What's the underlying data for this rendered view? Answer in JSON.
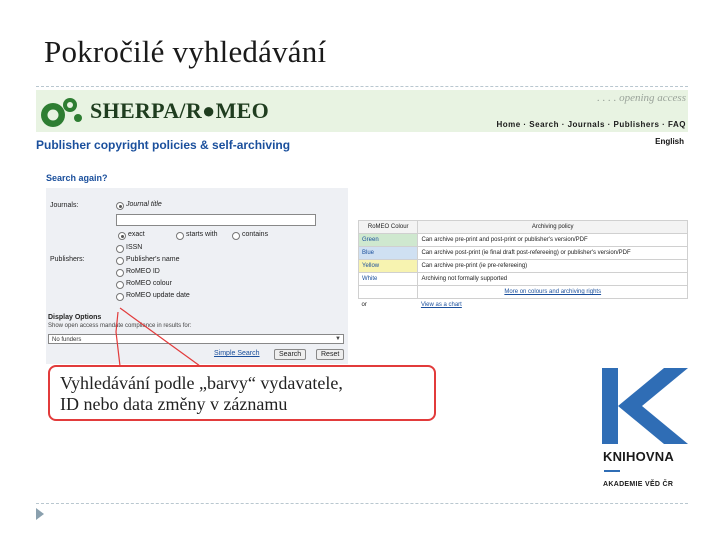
{
  "slide": {
    "title": "Pokročilé vyhledávání"
  },
  "romeo": {
    "brand": "SHERPA/R●MEO",
    "tagline": ". . . . opening access",
    "nav": [
      "Home",
      "Search",
      "Journals",
      "Publishers",
      "FAQ"
    ],
    "subtitle": "Publisher copyright policies & self-archiving",
    "language": "English",
    "search_again": "Search again?",
    "form": {
      "journals_label": "Journals:",
      "journal_title_option": "Journal title",
      "journal_title_value": "",
      "match_options": [
        "exact",
        "starts with",
        "contains"
      ],
      "issn_option": "ISSN",
      "publishers_label": "Publishers:",
      "publisher_options": [
        "Publisher's name",
        "RoMEO ID",
        "RoMEO colour",
        "RoMEO update date"
      ],
      "display_options_label": "Display Options",
      "display_options_sub": "Show open access mandate compliance in results for:",
      "display_select_value": "No funders",
      "simple_search_link": "Simple Search",
      "search_button": "Search",
      "reset_button": "Reset"
    },
    "colour_table": {
      "headers": [
        "RoMEO Colour",
        "Archiving policy"
      ],
      "rows": [
        {
          "colour": "Green",
          "policy": "Can archive pre-print and post-print or publisher's version/PDF"
        },
        {
          "colour": "Blue",
          "policy": "Can archive post-print (ie final draft post-refereeing) or publisher's version/PDF"
        },
        {
          "colour": "Yellow",
          "policy": "Can archive pre-print (ie pre-refereeing)"
        },
        {
          "colour": "White",
          "policy": "Archiving not formally supported"
        }
      ],
      "more_link": "More on colours and archiving rights",
      "last_row": {
        "colour": "or",
        "policy": "View as a chart"
      }
    }
  },
  "callout": {
    "line1": "Vyhledávání podle „barvy“ vydavatele,",
    "line2": "ID nebo data změny v záznamu"
  },
  "library": {
    "name": "KNIHOVNA",
    "academy": "AKADEMIE VĚD ČR"
  },
  "colors": {
    "accent_red": "#e23b3b",
    "romeo_blue": "#1a4f9c",
    "banner_green": "#e8f3e2",
    "library_blue": "#2f6db5"
  }
}
